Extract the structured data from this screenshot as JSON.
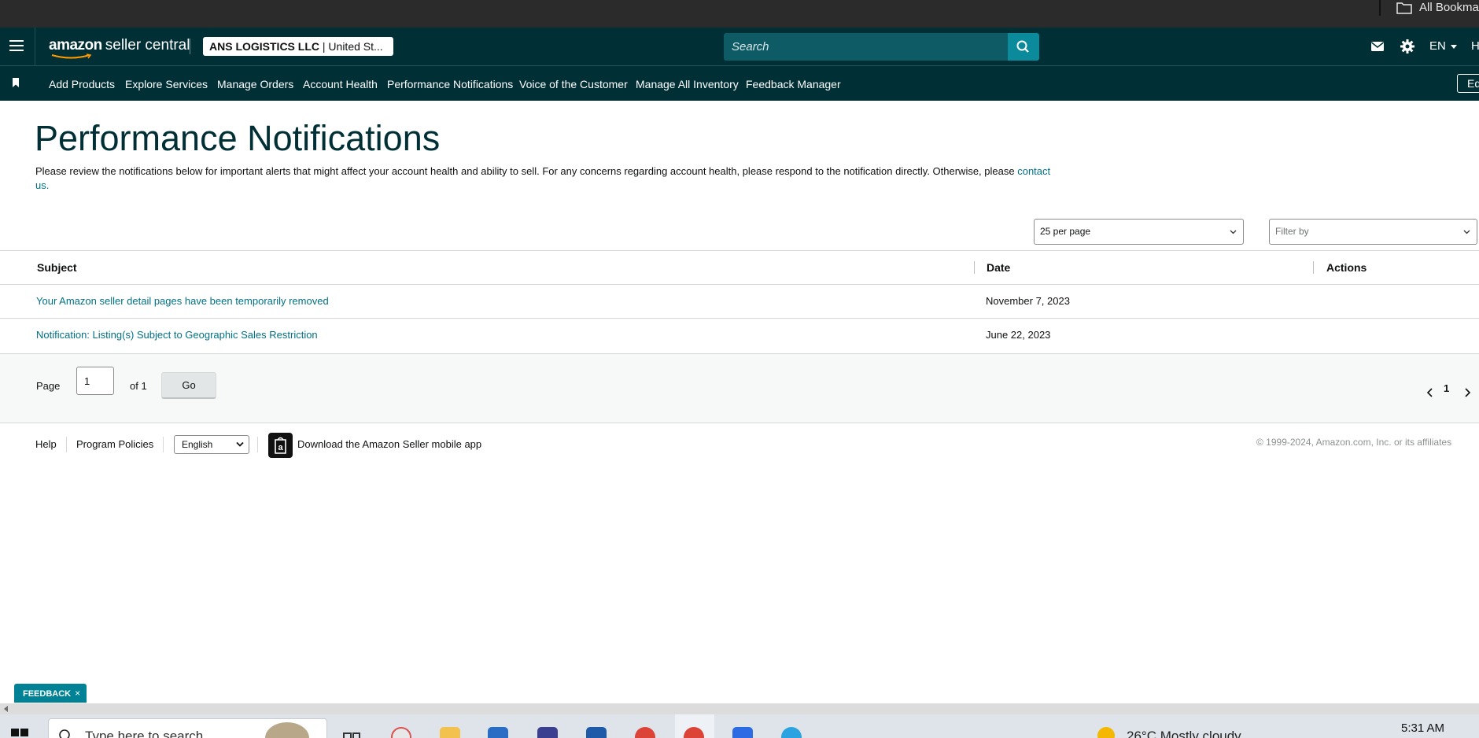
{
  "browser": {
    "bookmarks_label": "All Bookma"
  },
  "header": {
    "logo_brand": "amazon",
    "logo_product": "seller central",
    "account_name": "ANS LOGISTICS LLC",
    "account_region": "| United St...",
    "search_placeholder": "Search",
    "language": "EN",
    "overflow_initial": "H"
  },
  "nav": {
    "items": [
      "Add Products",
      "Explore Services",
      "Manage Orders",
      "Account Health",
      "Performance Notifications",
      "Voice of the Customer",
      "Manage All Inventory",
      "Feedback Manager"
    ],
    "edit_label": "Ed"
  },
  "main": {
    "title": "Performance Notifications",
    "description": "Please review the notifications below for important alerts that might affect your account health and ability to sell. For any concerns regarding account health, please respond to the notification directly. Otherwise, please",
    "contact_link": "contact us.",
    "per_page_value": "25 per page",
    "filter_placeholder": "Filter by"
  },
  "table": {
    "columns": [
      "Subject",
      "Date",
      "Actions"
    ],
    "rows": [
      {
        "subject": "Your Amazon seller detail pages have been temporarily removed",
        "date": "November 7, 2023"
      },
      {
        "subject": "Notification: Listing(s) Subject to Geographic Sales Restriction",
        "date": "June 22, 2023"
      }
    ]
  },
  "pagination": {
    "page_label": "Page",
    "page_value": "1",
    "of_label": "of 1",
    "go_label": "Go",
    "current_page": "1"
  },
  "footer": {
    "help": "Help",
    "policies": "Program Policies",
    "language": "English",
    "app_text": "Download the Amazon Seller mobile app",
    "copyright": "© 1999-2024, Amazon.com, Inc. or its affiliates"
  },
  "feedback": {
    "label": "FEEDBACK",
    "close": "×"
  },
  "taskbar": {
    "search_text": "Type here to search",
    "weather": "26°C  Mostly cloudy",
    "time": "5:31 AM"
  },
  "colors": {
    "header_bg": "#002f36",
    "link": "#007185",
    "feedback_bg": "#008296"
  }
}
